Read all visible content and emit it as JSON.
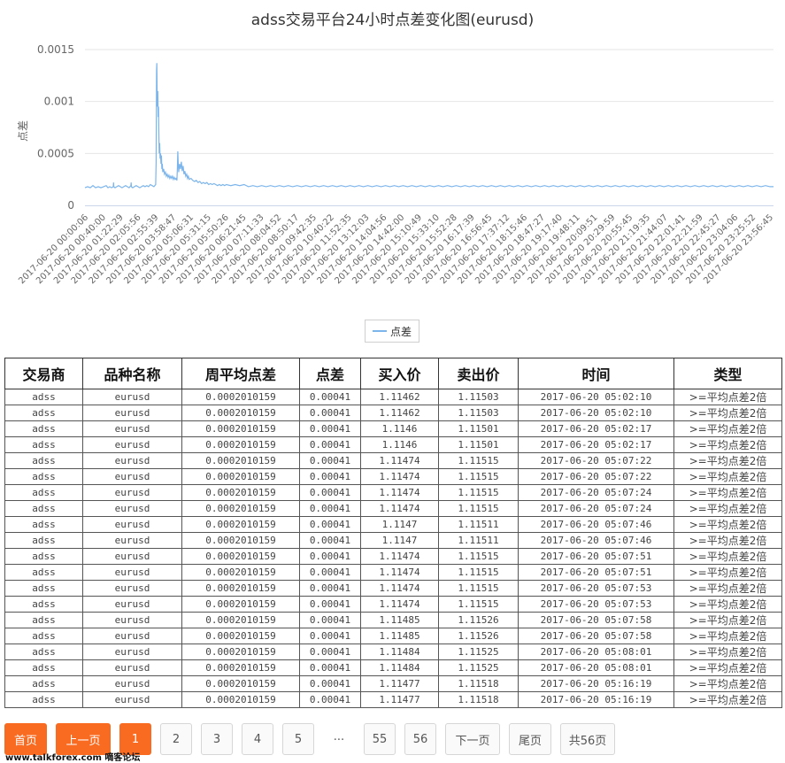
{
  "chart_data": {
    "type": "line",
    "title": "adss交易平台24小时点差变化图(eurusd)",
    "ylabel": "点差",
    "xlabel": "",
    "ylim": [
      0,
      0.0015
    ],
    "yticks": [
      "0",
      "0.0005",
      "0.001",
      "0.0015"
    ],
    "grid": true,
    "legend_position": "bottom-center",
    "color": "#7cb5ec",
    "series": [
      {
        "name": "点差"
      }
    ],
    "x_tick_labels": [
      "2017-06-20 00:00:06",
      "2017-06-20 00:40:00",
      "2017-06-20 01:22:29",
      "2017-06-20 02:05:56",
      "2017-06-20 02:55:39",
      "2017-06-20 03:58:47",
      "2017-06-20 05:06:31",
      "2017-06-20 05:31:15",
      "2017-06-20 05:50:26",
      "2017-06-20 06:21:45",
      "2017-06-20 07:11:33",
      "2017-06-20 08:04:52",
      "2017-06-20 08:50:17",
      "2017-06-20 09:42:35",
      "2017-06-20 10:40:22",
      "2017-06-20 11:52:35",
      "2017-06-20 13:12:03",
      "2017-06-20 14:04:56",
      "2017-06-20 14:42:00",
      "2017-06-20 15:10:49",
      "2017-06-20 15:33:10",
      "2017-06-20 15:52:28",
      "2017-06-20 16:17:39",
      "2017-06-20 16:56:45",
      "2017-06-20 17:37:12",
      "2017-06-20 18:15:46",
      "2017-06-20 18:47:27",
      "2017-06-20 19:17:40",
      "2017-06-20 19:48:11",
      "2017-06-20 20:09:51",
      "2017-06-20 20:29:59",
      "2017-06-20 20:55:45",
      "2017-06-20 21:19:35",
      "2017-06-20 21:44:07",
      "2017-06-20 22:01:41",
      "2017-06-20 22:21:59",
      "2017-06-20 22:45:27",
      "2017-06-20 23:04:06",
      "2017-06-20 23:25:52",
      "2017-06-20 23:56:45"
    ],
    "points": [
      [
        0,
        0.00017
      ],
      [
        3,
        0.00018
      ],
      [
        6,
        0.00017
      ],
      [
        9,
        0.00019
      ],
      [
        12,
        0.00017
      ],
      [
        15,
        0.00018
      ],
      [
        18,
        0.00017
      ],
      [
        21,
        0.00018
      ],
      [
        24,
        0.00019
      ],
      [
        26,
        0.00017
      ],
      [
        28,
        0.00018
      ],
      [
        30,
        0.00017
      ],
      [
        32,
        0.00018
      ],
      [
        32.3,
        0.00022
      ],
      [
        32.6,
        0.00018
      ],
      [
        34,
        0.00017
      ],
      [
        36,
        0.00018
      ],
      [
        38,
        0.00019
      ],
      [
        40,
        0.00018
      ],
      [
        42,
        0.00017
      ],
      [
        44,
        0.00018
      ],
      [
        46,
        0.00019
      ],
      [
        48,
        0.00018
      ],
      [
        50,
        0.00017
      ],
      [
        51,
        0.00018
      ],
      [
        52,
        0.00019
      ],
      [
        52.3,
        0.00022
      ],
      [
        52.6,
        0.00018
      ],
      [
        54,
        0.00017
      ],
      [
        56,
        0.00018
      ],
      [
        58,
        0.00019
      ],
      [
        60,
        0.00018
      ],
      [
        62,
        0.00017
      ],
      [
        64,
        0.00018
      ],
      [
        66,
        0.00019
      ],
      [
        68,
        0.00018
      ],
      [
        70,
        0.00019
      ],
      [
        72,
        0.00018
      ],
      [
        74,
        0.0002
      ],
      [
        76,
        0.00019
      ],
      [
        78,
        0.00018
      ],
      [
        80,
        0.0002
      ],
      [
        80.5,
        0.00041
      ],
      [
        81,
        0.0013
      ],
      [
        81.3,
        0.00137
      ],
      [
        81.6,
        0.0011
      ],
      [
        82,
        0.00095
      ],
      [
        82.4,
        0.0011
      ],
      [
        82.8,
        0.00085
      ],
      [
        83.2,
        0.00095
      ],
      [
        83.6,
        0.0007
      ],
      [
        84,
        0.0005
      ],
      [
        84.5,
        0.0006
      ],
      [
        85,
        0.00045
      ],
      [
        85.5,
        0.0005
      ],
      [
        86,
        0.0004
      ],
      [
        86.5,
        0.00048
      ],
      [
        87,
        0.00035
      ],
      [
        87.5,
        0.0004
      ],
      [
        88,
        0.00032
      ],
      [
        89,
        0.00035
      ],
      [
        90,
        0.0003
      ],
      [
        91,
        0.00032
      ],
      [
        92,
        0.00028
      ],
      [
        93,
        0.0003
      ],
      [
        94,
        0.00027
      ],
      [
        95,
        0.00029
      ],
      [
        96,
        0.00026
      ],
      [
        97,
        0.00028
      ],
      [
        98,
        0.00026
      ],
      [
        99,
        0.00028
      ],
      [
        100,
        0.00025
      ],
      [
        101,
        0.00027
      ],
      [
        102,
        0.00025
      ],
      [
        103,
        0.00026
      ],
      [
        104,
        0.00024
      ],
      [
        104.5,
        0.00035
      ],
      [
        105,
        0.00052
      ],
      [
        105.5,
        0.0004
      ],
      [
        106,
        0.00032
      ],
      [
        107,
        0.0004
      ],
      [
        108,
        0.00035
      ],
      [
        109,
        0.00042
      ],
      [
        110,
        0.00033
      ],
      [
        111,
        0.00038
      ],
      [
        112,
        0.0003
      ],
      [
        113,
        0.00033
      ],
      [
        114,
        0.00028
      ],
      [
        115,
        0.0003
      ],
      [
        116,
        0.00026
      ],
      [
        117,
        0.00028
      ],
      [
        118,
        0.00025
      ],
      [
        120,
        0.00026
      ],
      [
        122,
        0.00024
      ],
      [
        124,
        0.00023
      ],
      [
        126,
        0.00024
      ],
      [
        128,
        0.00022
      ],
      [
        130,
        0.00023
      ],
      [
        132,
        0.00021
      ],
      [
        134,
        0.00022
      ],
      [
        136,
        0.00021
      ],
      [
        138,
        0.00022
      ],
      [
        140,
        0.0002
      ],
      [
        142,
        0.00021
      ],
      [
        144,
        0.0002
      ],
      [
        146,
        0.00021
      ],
      [
        148,
        0.0002
      ],
      [
        150,
        0.00019
      ],
      [
        152,
        0.0002
      ],
      [
        154,
        0.00019
      ],
      [
        156,
        0.0002
      ],
      [
        158,
        0.00019
      ],
      [
        160,
        0.0002
      ],
      [
        165,
        0.00019
      ],
      [
        170,
        0.0002
      ],
      [
        175,
        0.00019
      ],
      [
        180,
        0.0002
      ],
      [
        185,
        0.00018
      ],
      [
        190,
        0.00019
      ],
      [
        195,
        0.00018
      ],
      [
        200,
        0.00019
      ],
      [
        205,
        0.00018
      ],
      [
        210,
        0.00019
      ],
      [
        215,
        0.00018
      ],
      [
        220,
        0.00019
      ],
      [
        225,
        0.00018
      ],
      [
        230,
        0.00019
      ],
      [
        235,
        0.00018
      ],
      [
        240,
        0.00019
      ],
      [
        245,
        0.00018
      ],
      [
        250,
        0.00019
      ],
      [
        255,
        0.00018
      ],
      [
        260,
        0.00019
      ],
      [
        265,
        0.00018
      ],
      [
        270,
        0.00019
      ],
      [
        275,
        0.00018
      ],
      [
        280,
        0.00019
      ],
      [
        285,
        0.00018
      ],
      [
        290,
        0.00019
      ],
      [
        295,
        0.00018
      ],
      [
        300,
        0.00019
      ],
      [
        305,
        0.00018
      ],
      [
        310,
        0.00019
      ],
      [
        315,
        0.00018
      ],
      [
        320,
        0.00019
      ],
      [
        325,
        0.00018
      ],
      [
        330,
        0.00019
      ],
      [
        335,
        0.00018
      ],
      [
        340,
        0.00019
      ],
      [
        345,
        0.00018
      ],
      [
        350,
        0.00019
      ],
      [
        355,
        0.00018
      ],
      [
        360,
        0.00019
      ],
      [
        365,
        0.00018
      ],
      [
        370,
        0.00019
      ],
      [
        375,
        0.00018
      ],
      [
        380,
        0.00019
      ],
      [
        385,
        0.00018
      ],
      [
        390,
        0.00019
      ],
      [
        395,
        0.00018
      ],
      [
        400,
        0.00019
      ],
      [
        405,
        0.00018
      ],
      [
        410,
        0.00019
      ],
      [
        415,
        0.00018
      ],
      [
        420,
        0.00019
      ],
      [
        425,
        0.00018
      ],
      [
        430,
        0.00019
      ],
      [
        435,
        0.00018
      ],
      [
        440,
        0.00019
      ],
      [
        445,
        0.00018
      ],
      [
        450,
        0.00019
      ],
      [
        455,
        0.00018
      ],
      [
        460,
        0.00019
      ],
      [
        465,
        0.00018
      ],
      [
        470,
        0.00019
      ],
      [
        475,
        0.00018
      ],
      [
        480,
        0.00019
      ],
      [
        485,
        0.00018
      ],
      [
        490,
        0.00019
      ],
      [
        495,
        0.00018
      ],
      [
        500,
        0.00019
      ],
      [
        505,
        0.00018
      ],
      [
        510,
        0.00019
      ],
      [
        515,
        0.00018
      ],
      [
        520,
        0.00019
      ],
      [
        525,
        0.00018
      ],
      [
        530,
        0.00019
      ],
      [
        535,
        0.00018
      ],
      [
        540,
        0.00019
      ],
      [
        545,
        0.00018
      ],
      [
        550,
        0.00019
      ],
      [
        555,
        0.00018
      ],
      [
        560,
        0.00019
      ],
      [
        565,
        0.00018
      ],
      [
        570,
        0.00019
      ],
      [
        575,
        0.00018
      ],
      [
        580,
        0.00019
      ],
      [
        585,
        0.00018
      ],
      [
        590,
        0.00019
      ],
      [
        595,
        0.00018
      ],
      [
        600,
        0.00019
      ],
      [
        605,
        0.00018
      ],
      [
        610,
        0.00019
      ],
      [
        615,
        0.00018
      ],
      [
        620,
        0.00019
      ],
      [
        625,
        0.00018
      ],
      [
        630,
        0.00019
      ],
      [
        635,
        0.00018
      ],
      [
        640,
        0.00019
      ],
      [
        645,
        0.00018
      ],
      [
        650,
        0.00019
      ],
      [
        655,
        0.00018
      ],
      [
        660,
        0.00019
      ],
      [
        665,
        0.00018
      ],
      [
        670,
        0.00019
      ],
      [
        675,
        0.00018
      ],
      [
        680,
        0.00019
      ],
      [
        685,
        0.00018
      ],
      [
        690,
        0.00019
      ],
      [
        695,
        0.00018
      ],
      [
        700,
        0.00019
      ],
      [
        705,
        0.00018
      ],
      [
        710,
        0.00019
      ],
      [
        715,
        0.00018
      ],
      [
        720,
        0.00019
      ],
      [
        725,
        0.00018
      ],
      [
        730,
        0.00019
      ],
      [
        735,
        0.00018
      ],
      [
        740,
        0.00019
      ],
      [
        745,
        0.00018
      ],
      [
        750,
        0.00019
      ],
      [
        755,
        0.00018
      ],
      [
        760,
        0.00019
      ],
      [
        765,
        0.00018
      ],
      [
        770,
        0.00019
      ],
      [
        775,
        0.00018
      ],
      [
        779,
        0.00018
      ]
    ]
  },
  "table": {
    "headers": [
      "交易商",
      "品种名称",
      "周平均点差",
      "点差",
      "买入价",
      "卖出价",
      "时间",
      "类型"
    ],
    "rows": [
      [
        "adss",
        "eurusd",
        "0.0002010159",
        "0.00041",
        "1.11462",
        "1.11503",
        "2017-06-20 05:02:10",
        ">=平均点差2倍"
      ],
      [
        "adss",
        "eurusd",
        "0.0002010159",
        "0.00041",
        "1.11462",
        "1.11503",
        "2017-06-20 05:02:10",
        ">=平均点差2倍"
      ],
      [
        "adss",
        "eurusd",
        "0.0002010159",
        "0.00041",
        "1.1146",
        "1.11501",
        "2017-06-20 05:02:17",
        ">=平均点差2倍"
      ],
      [
        "adss",
        "eurusd",
        "0.0002010159",
        "0.00041",
        "1.1146",
        "1.11501",
        "2017-06-20 05:02:17",
        ">=平均点差2倍"
      ],
      [
        "adss",
        "eurusd",
        "0.0002010159",
        "0.00041",
        "1.11474",
        "1.11515",
        "2017-06-20 05:07:22",
        ">=平均点差2倍"
      ],
      [
        "adss",
        "eurusd",
        "0.0002010159",
        "0.00041",
        "1.11474",
        "1.11515",
        "2017-06-20 05:07:22",
        ">=平均点差2倍"
      ],
      [
        "adss",
        "eurusd",
        "0.0002010159",
        "0.00041",
        "1.11474",
        "1.11515",
        "2017-06-20 05:07:24",
        ">=平均点差2倍"
      ],
      [
        "adss",
        "eurusd",
        "0.0002010159",
        "0.00041",
        "1.11474",
        "1.11515",
        "2017-06-20 05:07:24",
        ">=平均点差2倍"
      ],
      [
        "adss",
        "eurusd",
        "0.0002010159",
        "0.00041",
        "1.1147",
        "1.11511",
        "2017-06-20 05:07:46",
        ">=平均点差2倍"
      ],
      [
        "adss",
        "eurusd",
        "0.0002010159",
        "0.00041",
        "1.1147",
        "1.11511",
        "2017-06-20 05:07:46",
        ">=平均点差2倍"
      ],
      [
        "adss",
        "eurusd",
        "0.0002010159",
        "0.00041",
        "1.11474",
        "1.11515",
        "2017-06-20 05:07:51",
        ">=平均点差2倍"
      ],
      [
        "adss",
        "eurusd",
        "0.0002010159",
        "0.00041",
        "1.11474",
        "1.11515",
        "2017-06-20 05:07:51",
        ">=平均点差2倍"
      ],
      [
        "adss",
        "eurusd",
        "0.0002010159",
        "0.00041",
        "1.11474",
        "1.11515",
        "2017-06-20 05:07:53",
        ">=平均点差2倍"
      ],
      [
        "adss",
        "eurusd",
        "0.0002010159",
        "0.00041",
        "1.11474",
        "1.11515",
        "2017-06-20 05:07:53",
        ">=平均点差2倍"
      ],
      [
        "adss",
        "eurusd",
        "0.0002010159",
        "0.00041",
        "1.11485",
        "1.11526",
        "2017-06-20 05:07:58",
        ">=平均点差2倍"
      ],
      [
        "adss",
        "eurusd",
        "0.0002010159",
        "0.00041",
        "1.11485",
        "1.11526",
        "2017-06-20 05:07:58",
        ">=平均点差2倍"
      ],
      [
        "adss",
        "eurusd",
        "0.0002010159",
        "0.00041",
        "1.11484",
        "1.11525",
        "2017-06-20 05:08:01",
        ">=平均点差2倍"
      ],
      [
        "adss",
        "eurusd",
        "0.0002010159",
        "0.00041",
        "1.11484",
        "1.11525",
        "2017-06-20 05:08:01",
        ">=平均点差2倍"
      ],
      [
        "adss",
        "eurusd",
        "0.0002010159",
        "0.00041",
        "1.11477",
        "1.11518",
        "2017-06-20 05:16:19",
        ">=平均点差2倍"
      ],
      [
        "adss",
        "eurusd",
        "0.0002010159",
        "0.00041",
        "1.11477",
        "1.11518",
        "2017-06-20 05:16:19",
        ">=平均点差2倍"
      ]
    ]
  },
  "pagination": {
    "first": "首页",
    "prev": "上一页",
    "pages": [
      "1",
      "2",
      "3",
      "4",
      "5"
    ],
    "ellipsis": "···",
    "tail_pages": [
      "55",
      "56"
    ],
    "next": "下一页",
    "last": "尾页",
    "total": "共56页",
    "active_color": "#f96b20"
  },
  "watermark": "www.talkforex.com 嘀客论坛"
}
